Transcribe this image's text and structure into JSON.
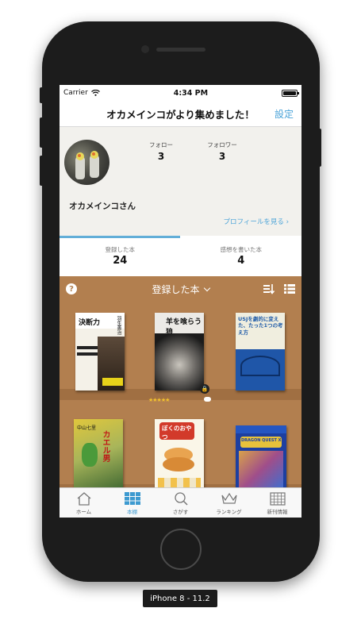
{
  "status_bar": {
    "carrier": "Carrier",
    "time": "4:34 PM"
  },
  "nav": {
    "title": "オカメインコがより集めました！",
    "settings_label": "設定"
  },
  "profile": {
    "follow_label": "フォロー",
    "follow_count": "3",
    "follower_label": "フォロワー",
    "follower_count": "3",
    "name": "オカメインコさん",
    "profile_link": "プロフィールを見る",
    "profile_link_chevron": "›"
  },
  "segments": [
    {
      "label": "登録した本",
      "value": "24"
    },
    {
      "label": "感想を書いた本",
      "value": "4"
    }
  ],
  "shelf": {
    "help_glyph": "?",
    "title": "登録した本",
    "books": [
      {
        "cover_text": "決断力",
        "cover_subtext": "羽生善治"
      },
      {
        "cover_text": "羊を喰らう狼",
        "cover_subtext": ""
      },
      {
        "cover_text": "USJを劇的に変えた、たった1つの考え方",
        "cover_subtext": ""
      },
      {
        "cover_text": "カエル男",
        "cover_subtext": "中山七里"
      },
      {
        "cover_text": "ぼくのおやつ",
        "cover_subtext": ""
      },
      {
        "cover_text": "DRAGON QUEST XI",
        "cover_subtext": ""
      }
    ],
    "rating_stars": "★★★★★",
    "lock_glyph": "🔒"
  },
  "tabbar": [
    {
      "label": "ホーム",
      "icon": "home-icon"
    },
    {
      "label": "本棚",
      "icon": "bookshelf-icon"
    },
    {
      "label": "さがす",
      "icon": "search-icon"
    },
    {
      "label": "ランキング",
      "icon": "crown-icon"
    },
    {
      "label": "新刊情報",
      "icon": "calendar-icon"
    }
  ],
  "device_label": "iPhone 8 - 11.2",
  "colors": {
    "accent": "#4aa3d8",
    "shelf": "#b27f4f",
    "tab_indicator": "#62aed8"
  }
}
